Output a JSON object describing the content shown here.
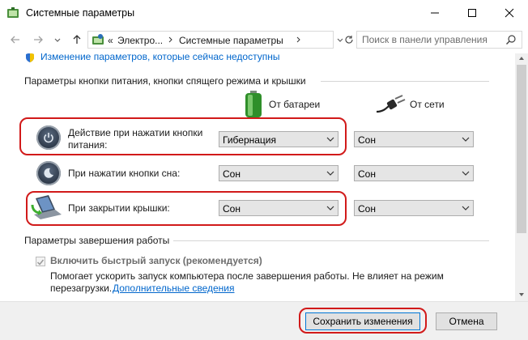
{
  "window": {
    "title": "Системные параметры"
  },
  "address": {
    "prefix": "«",
    "crumbs": [
      "Электро...",
      "Системные параметры"
    ]
  },
  "search": {
    "placeholder": "Поиск в панели управления"
  },
  "content": {
    "change_settings_link": "Изменение параметров, которые сейчас недоступны",
    "power_section_title": "Параметры кнопки питания, кнопки спящего режима и крышки",
    "columns": {
      "battery": "От батареи",
      "plugged": "От сети"
    },
    "rows": [
      {
        "label": "Действие при нажатии кнопки питания:",
        "battery": "Гибернация",
        "plugged": "Сон"
      },
      {
        "label": "При нажатии кнопки сна:",
        "battery": "Сон",
        "plugged": "Сон"
      },
      {
        "label": "При закрытии крышки:",
        "battery": "Сон",
        "plugged": "Сон"
      }
    ],
    "shutdown_section_title": "Параметры завершения работы",
    "fast_startup": {
      "label": "Включить быстрый запуск (рекомендуется)",
      "description": "Помогает ускорить запуск компьютера после завершения работы. Не влияет на режим",
      "description2": "перезагрузки.",
      "more_link": "Дополнительные сведения"
    }
  },
  "buttons": {
    "save": "Сохранить изменения",
    "cancel": "Отмена"
  }
}
